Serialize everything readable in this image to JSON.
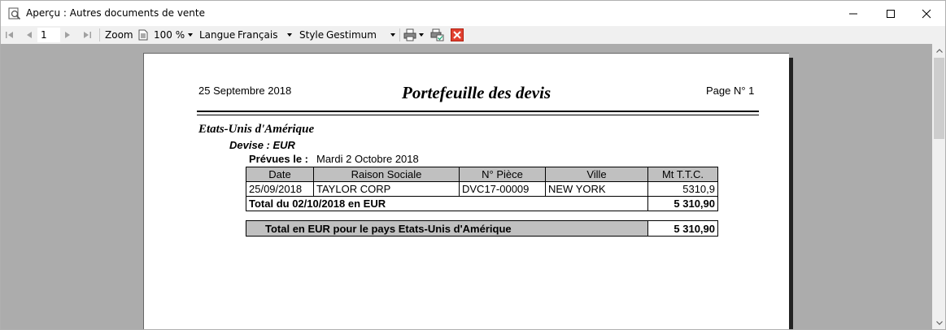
{
  "window": {
    "title": "Aperçu : Autres documents de vente"
  },
  "toolbar": {
    "page_number": "1",
    "zoom_label": "Zoom",
    "zoom_value": "100 %",
    "langue_label": "Langue",
    "langue_value": "Français",
    "style_label": "Style",
    "style_value": "Gestimum"
  },
  "report": {
    "date": "25 Septembre 2018",
    "title": "Portefeuille des devis",
    "page_label": "Page N° 1",
    "country": "Etats-Unis d'Amérique",
    "devise": "Devise : EUR",
    "prevues_label": "Prévues le :",
    "prevues_value": "Mardi 2 Octobre 2018",
    "columns": [
      "Date",
      "Raison Sociale",
      "N° Pièce",
      "Ville",
      "Mt T.T.C."
    ],
    "rows": [
      {
        "date": "25/09/2018",
        "raison_sociale": "TAYLOR CORP",
        "piece": "DVC17-00009",
        "ville": "NEW YORK",
        "montant": "5310,9"
      }
    ],
    "subtotal_label": "Total du 02/10/2018 en EUR",
    "subtotal_value": "5 310,90",
    "total_label": "Total en EUR pour le pays Etats-Unis d'Amérique",
    "total_value": "5 310,90"
  },
  "colors": {
    "viewer_bg": "#acacac",
    "header_cell_bg": "#c0c0c0",
    "close_button_red": "#e04030"
  }
}
